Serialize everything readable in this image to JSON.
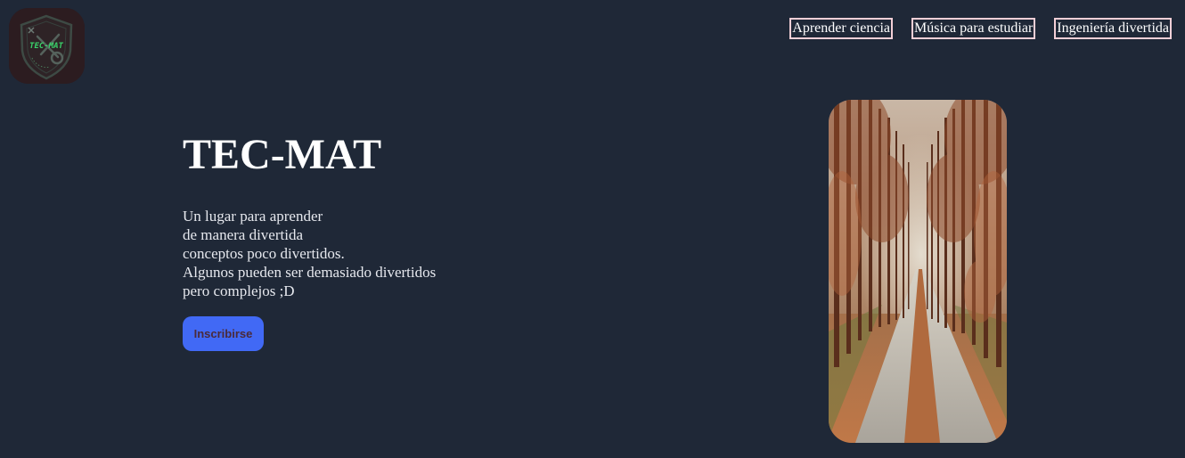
{
  "header": {
    "logo": {
      "text": "TEC-MAT",
      "icon": "shield-logo-icon",
      "colors": {
        "background": "#2c1c20",
        "accent": "#3ad36a"
      }
    },
    "nav": [
      {
        "label": "Aprender ciencia"
      },
      {
        "label": "Música para estudiar"
      },
      {
        "label": "Ingeniería divertida"
      }
    ]
  },
  "hero": {
    "title": "TEC-MAT",
    "description_lines": [
      "Un lugar para aprender",
      "de manera divertida",
      "conceptos poco divertidos.",
      "Algunos pueden ser demasiado divertidos",
      "pero complejos ;D"
    ],
    "cta_label": "Inscribirse",
    "image": {
      "subject": "forest-path-image"
    }
  },
  "colors": {
    "background": "#1f2837",
    "nav_border": "#f3cfd6",
    "button": "#4169f5",
    "button_text": "#4a2a3a",
    "text": "#ffffff"
  }
}
